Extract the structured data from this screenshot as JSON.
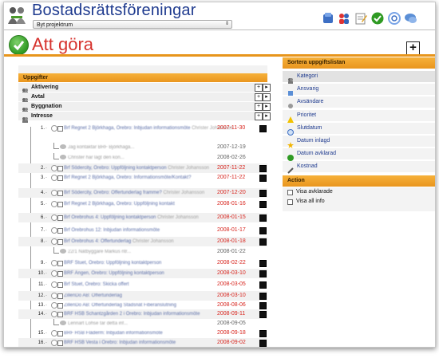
{
  "header": {
    "app_title": "Bostadsrättsföreningar",
    "project_select_value": "Byt projektrum",
    "toolbar_icons": [
      "users-icon",
      "people-icon",
      "notes-icon",
      "check-icon",
      "help-icon",
      "chat-icon"
    ]
  },
  "page": {
    "title": "Att göra",
    "add_label": "+"
  },
  "tasks_panel": {
    "title": "Uppgifter",
    "categories": [
      {
        "label": "Aktivering"
      },
      {
        "label": "Avtal"
      },
      {
        "label": "Byggnation"
      },
      {
        "label": "Intresse"
      }
    ],
    "tasks": [
      {
        "num": "1.",
        "title": "Brf Regnet 2 Björkhaga, Örebro: Inbjudan informationsmöte",
        "who": "Christer Johansson",
        "date": "2007-11-30"
      },
      {
        "num": "2.",
        "title": "Brf Södercity, Örebro: Uppföljning kontaktperson",
        "who": "Christer Johansson",
        "date": "2007-11-22"
      },
      {
        "num": "3.",
        "title": "Brf Regnet 2 Björkhaga, Örebro: Informationsmöte/Kontakt?",
        "who": "",
        "date": "2007-11-22"
      },
      {
        "num": "4.",
        "title": "Brf Södercity, Örebro: Offertunderlag framme?",
        "who": "Christer Johansson",
        "date": "2007-12-20"
      },
      {
        "num": "5.",
        "title": "Brf Regnet 2 Björkhaga, Örebro: Uppföljning kontakt",
        "who": "",
        "date": "2008-01-16"
      },
      {
        "num": "6.",
        "title": "Brf Örebrohus 4: Uppföljning kontaktperson",
        "who": "Christer Johansson",
        "date": "2008-01-15"
      },
      {
        "num": "7.",
        "title": "Brf Örebrohus 12: Inbjudan informationsmöte",
        "who": "",
        "date": "2008-01-17"
      },
      {
        "num": "8.",
        "title": "Brf Örebrohus 4: Offertunderlag",
        "who": "Christer Johansson",
        "date": "2008-01-18"
      },
      {
        "num": "9.",
        "title": "BRF Stuet, Örebro: Uppföljning kontaktperson",
        "who": "",
        "date": "2008-02-22"
      },
      {
        "num": "10.",
        "title": "BRF Ängen, Örebro: Uppföljning kontaktperson",
        "who": "",
        "date": "2008-03-10"
      },
      {
        "num": "11.",
        "title": "Brf Stuet, Örebro: Skicka offert",
        "who": "",
        "date": "2008-03-05"
      },
      {
        "num": "12.",
        "title": "ZillenDo AB: Offertunderlag",
        "who": "",
        "date": "2008-03-10"
      },
      {
        "num": "13.",
        "title": "ZillenDo AB: Offertunderlag Stadsnät Fiberanslutning",
        "who": "",
        "date": "2008-08-06"
      },
      {
        "num": "14.",
        "title": "BRF HSB Schantzgården 2 i Örebro: Inbjudan informationsmöte",
        "who": "",
        "date": "2008-09-11"
      },
      {
        "num": "15.",
        "title": "BRF HSB Fläderm: Inbjudan informationsmöte",
        "who": "",
        "date": "2008-09-18"
      },
      {
        "num": "16.",
        "title": "BRF HSB Vesta i Örebro: Inbjudan informationsmöte",
        "who": "",
        "date": "2008-09-02"
      }
    ],
    "subs": [
      {
        "title": "Jag kontaktar BRF Björkhaga...",
        "date": "2007-12-19"
      },
      {
        "title": "Christer har lagt den kon...",
        "date": "2008-02-26"
      },
      {
        "title": "22/1 Nätbyggare Markus ntr...",
        "date": "2008-01-22"
      },
      {
        "title": "Lennart Lohse tar detta inf...",
        "date": "2008-09-05"
      }
    ]
  },
  "sort_panel": {
    "title": "Sortera uppgiftslistan",
    "items": [
      {
        "label": "Kategori",
        "icon": "category-icon"
      },
      {
        "label": "Ansvarig",
        "icon": "person-icon"
      },
      {
        "label": "Avsändare",
        "icon": "sender-icon"
      },
      {
        "label": "Prioritet",
        "icon": "warning-icon"
      },
      {
        "label": "Slutdatum",
        "icon": "clock-icon"
      },
      {
        "label": "Datum inlagd",
        "icon": "star-icon"
      },
      {
        "label": "Datum avklarad",
        "icon": "check-icon"
      },
      {
        "label": "Kostnad",
        "icon": "cost-icon"
      }
    ]
  },
  "action_panel": {
    "title": "Action",
    "options": [
      {
        "label": "Visa avklarade"
      },
      {
        "label": "Visa all info"
      }
    ]
  },
  "colors": {
    "title_blue": "#1f3b8f",
    "title_red": "#d6322d",
    "accent_orange": "#e9951e",
    "date_red": "#d8261f"
  }
}
